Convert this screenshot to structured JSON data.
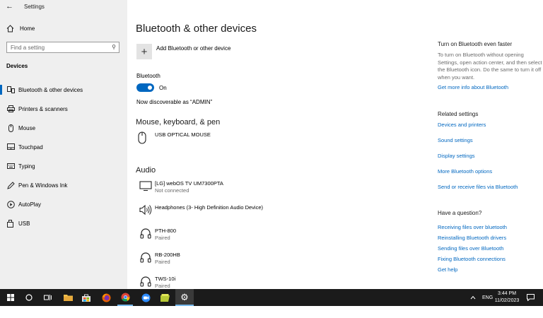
{
  "window": {
    "title": "Settings"
  },
  "sidebar": {
    "home": "Home",
    "search_placeholder": "Find a setting",
    "section": "Devices",
    "items": [
      {
        "label": "Bluetooth & other devices",
        "icon": "bluetooth-devices-icon"
      },
      {
        "label": "Printers & scanners",
        "icon": "printer-icon"
      },
      {
        "label": "Mouse",
        "icon": "mouse-icon"
      },
      {
        "label": "Touchpad",
        "icon": "touchpad-icon"
      },
      {
        "label": "Typing",
        "icon": "keyboard-icon"
      },
      {
        "label": "Pen & Windows Ink",
        "icon": "pen-icon"
      },
      {
        "label": "AutoPlay",
        "icon": "autoplay-icon"
      },
      {
        "label": "USB",
        "icon": "usb-icon"
      }
    ]
  },
  "main": {
    "title": "Bluetooth & other devices",
    "add_device": "Add Bluetooth or other device",
    "bluetooth_label": "Bluetooth",
    "bluetooth_state": "On",
    "discoverable": "Now discoverable as “ADMIN”",
    "mouse_section": "Mouse, keyboard, & pen",
    "mouse_devices": [
      {
        "name": "USB OPTICAL MOUSE",
        "status": ""
      }
    ],
    "audio_section": "Audio",
    "audio_devices": [
      {
        "name": "[LG] webOS TV UM7300PTA",
        "status": "Not connected"
      },
      {
        "name": "Headphones (3- High Definition Audio Device)",
        "status": ""
      },
      {
        "name": "PTH-800",
        "status": "Paired"
      },
      {
        "name": "RB-200HB",
        "status": "Paired"
      },
      {
        "name": "TWS-10i",
        "status": "Paired"
      }
    ]
  },
  "right": {
    "faster_title": "Turn on Bluetooth even faster",
    "faster_text": "To turn on Bluetooth without opening Settings, open action center, and then select the Bluetooth icon. Do the same to turn it off when you want.",
    "faster_link": "Get more info about Bluetooth",
    "related_title": "Related settings",
    "related_links": [
      "Devices and printers",
      "Sound settings",
      "Display settings",
      "More Bluetooth options",
      "Send or receive files via Bluetooth"
    ],
    "question_title": "Have a question?",
    "question_links": [
      "Receiving files over bluetooth",
      "Reinstalling Bluetooth drivers",
      "Sending files over Bluetooth",
      "Fixing Bluetooth connections",
      "Get help"
    ]
  },
  "taskbar": {
    "lang": "ENG",
    "time": "3:44 PM",
    "date": "11/02/2023"
  },
  "colors": {
    "accent": "#0067c0",
    "sidebar_bg": "#efefef",
    "taskbar_bg": "#1b1b1b"
  }
}
